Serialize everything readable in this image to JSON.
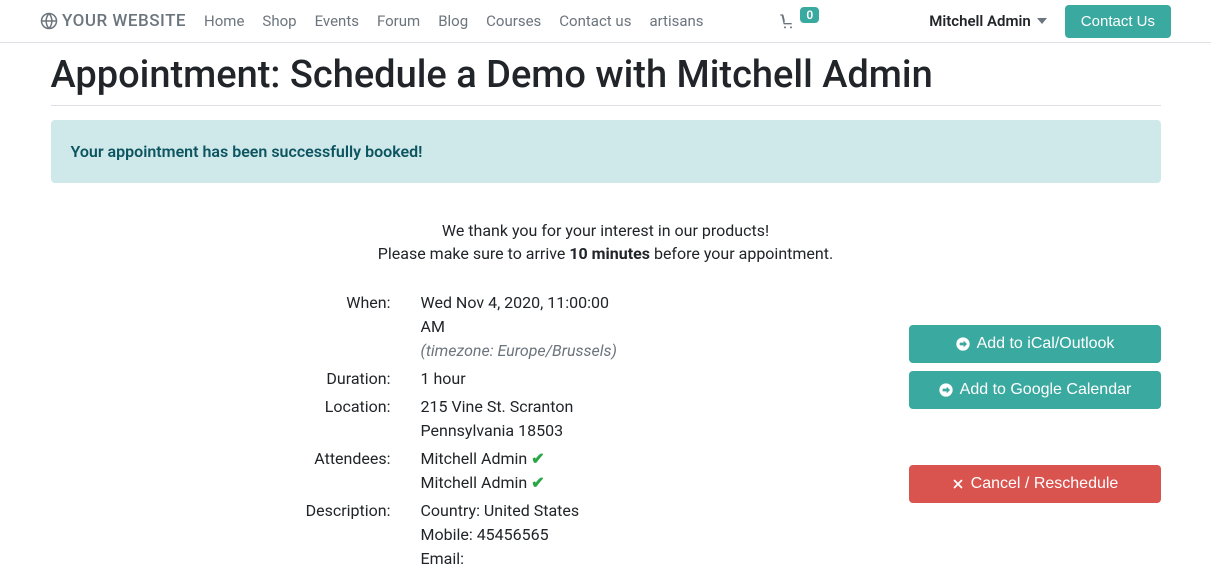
{
  "header": {
    "logo_text": "YOUR WEBSITE",
    "nav": [
      "Home",
      "Shop",
      "Events",
      "Forum",
      "Blog",
      "Courses",
      "Contact us",
      "artisans"
    ],
    "cart_count": "0",
    "user_name": "Mitchell Admin",
    "contact_button": "Contact Us"
  },
  "page_title": "Appointment: Schedule a Demo with Mitchell Admin",
  "alert": "Your appointment has been successfully booked!",
  "thanks_line1": "We thank you for your interest in our products!",
  "thanks_prefix": "Please make sure to arrive ",
  "thanks_bold": "10 minutes",
  "thanks_suffix": " before your appointment.",
  "labels": {
    "when": "When:",
    "duration": "Duration:",
    "location": "Location:",
    "attendees": "Attendees:",
    "description": "Description:"
  },
  "values": {
    "when_datetime": "Wed Nov 4, 2020, 11:00:00 AM",
    "when_tz": "(timezone: Europe/Brussels)",
    "duration": "1 hour",
    "location": "215 Vine St. Scranton Pennsylvania 18503",
    "attendees": [
      "Mitchell Admin",
      "Mitchell Admin"
    ],
    "description_lines": [
      "Country: United States",
      "Mobile: 45456565",
      "Email:"
    ]
  },
  "actions": {
    "ical": "Add to iCal/Outlook",
    "gcal": "Add to Google Calendar",
    "cancel": "Cancel / Reschedule"
  }
}
